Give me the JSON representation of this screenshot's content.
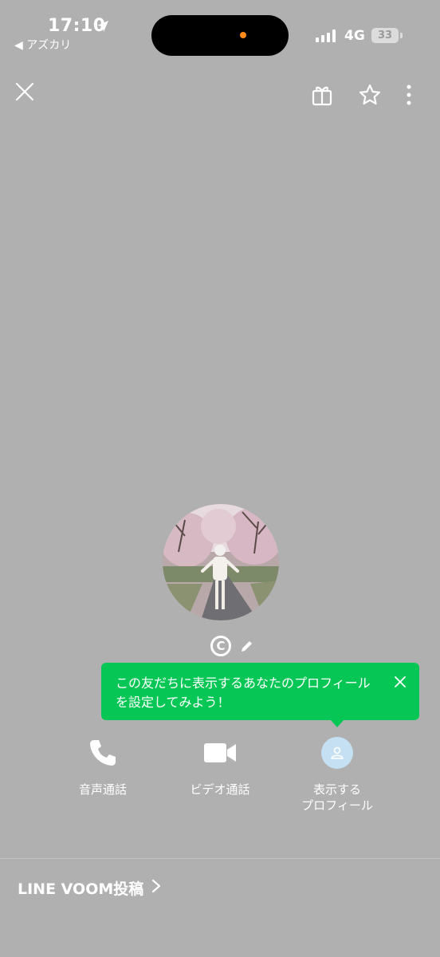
{
  "status_bar": {
    "time": "17:10",
    "back_app": "◀ アズカリ",
    "network": "4G",
    "battery": "33"
  },
  "colors": {
    "background": "#b0b0b0",
    "tooltip": "#06c755",
    "profile_icon_bg": "#c4e0f2"
  },
  "profile": {
    "name_icon": "copyright-c-badge"
  },
  "tooltip": {
    "text": "この友だちに表示するあなたのプロフィール\nを設定してみよう！"
  },
  "actions": {
    "voice_call": "音声通話",
    "video_call": "ビデオ通話",
    "display_profile": "表示する\nプロフィール"
  },
  "footer": {
    "voom_link": "LINE VOOM投稿"
  },
  "icons": {
    "close": "close-icon",
    "gift": "gift-icon",
    "favorite": "star-icon",
    "more": "more-vertical-icon",
    "edit": "pencil-icon",
    "phone": "phone-icon",
    "video": "video-camera-icon",
    "profile": "person-icon",
    "chevron": "chevron-right-icon"
  }
}
